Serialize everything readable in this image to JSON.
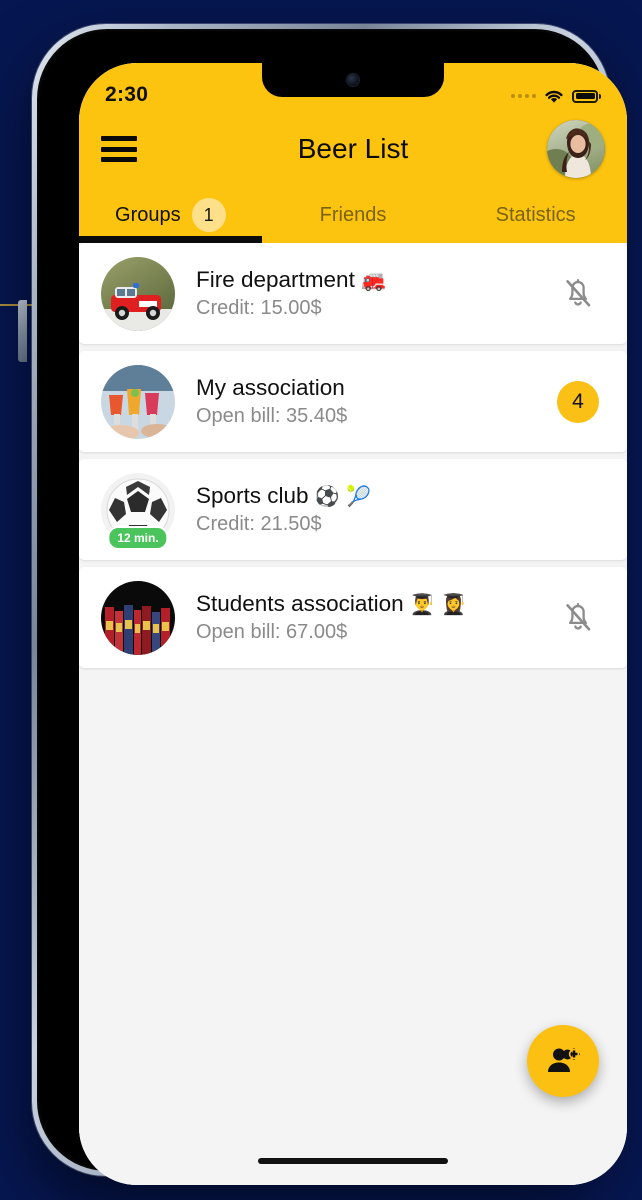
{
  "status_bar": {
    "time": "2:30",
    "signal_icon": "signal-dots-icon",
    "wifi_icon": "wifi-icon",
    "battery_icon": "battery-full-icon"
  },
  "app_bar": {
    "title": "Beer List",
    "menu_icon": "hamburger-menu-icon",
    "avatar_icon": "user-avatar"
  },
  "tabs": [
    {
      "label": "Groups",
      "badge": "1",
      "active": true
    },
    {
      "label": "Friends",
      "badge": "",
      "active": false
    },
    {
      "label": "Statistics",
      "badge": "",
      "active": false
    }
  ],
  "groups": [
    {
      "name": "Fire department",
      "emoji": "🚒",
      "subtitle": "Credit: 15.00$",
      "trailing": "bell-off-icon",
      "badge": "",
      "time_pill": ""
    },
    {
      "name": "My association",
      "emoji": "",
      "subtitle": "Open bill: 35.40$",
      "trailing": "count-badge",
      "badge": "4",
      "time_pill": ""
    },
    {
      "name": "Sports club",
      "emoji": "⚽ 🎾",
      "subtitle": "Credit: 21.50$",
      "trailing": "",
      "badge": "",
      "time_pill": "12 min."
    },
    {
      "name": "Students association",
      "emoji": "👨‍🎓 👩‍🎓",
      "subtitle": "Open bill: 67.00$",
      "trailing": "bell-off-icon",
      "badge": "",
      "time_pill": ""
    }
  ],
  "fab": {
    "icon": "add-group-icon",
    "label": ""
  },
  "colors": {
    "brand_yellow": "#FDC40F",
    "badge_yellow": "#FBC016",
    "tab_badge_yellow": "#FFE08A",
    "green_pill": "#4CC45E",
    "page_background": "#061650",
    "list_background": "#F4F4F4"
  }
}
